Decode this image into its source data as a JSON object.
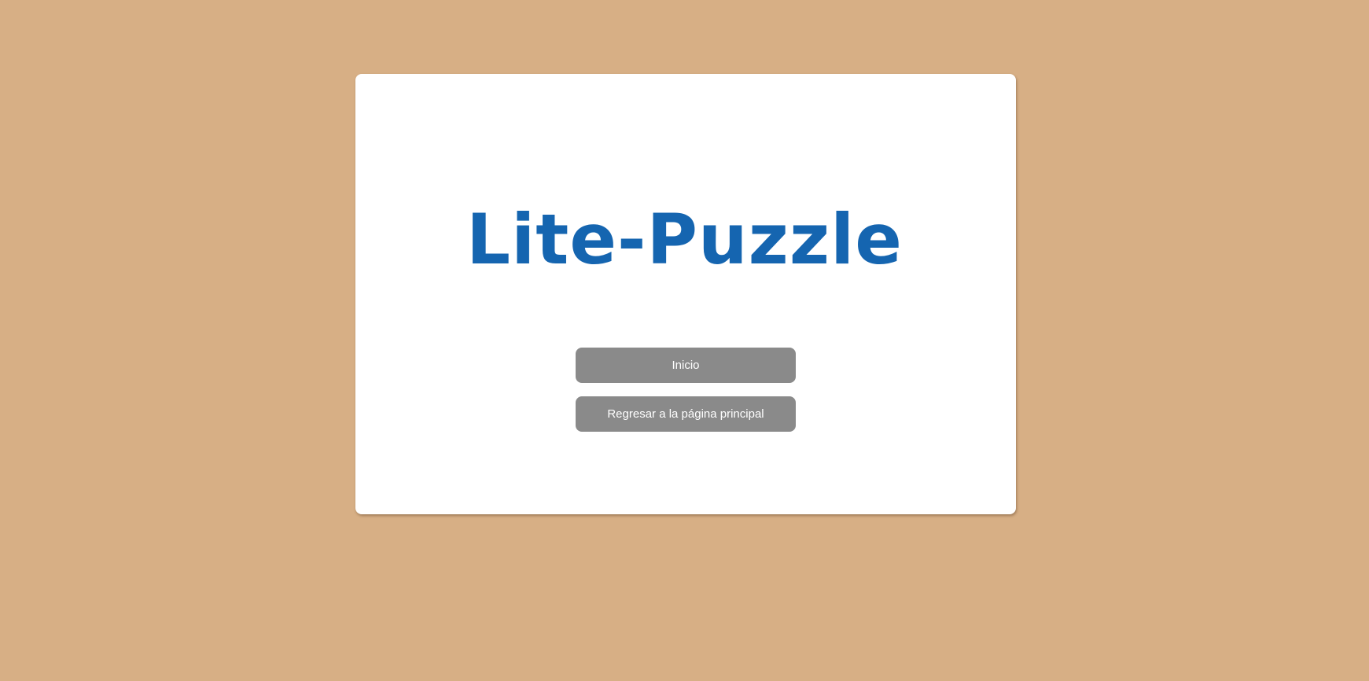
{
  "page": {
    "background_color": "#d7af85",
    "card_color": "#ffffff"
  },
  "title": {
    "text": "Lite-Puzzle",
    "color": "#1565b0"
  },
  "buttons": {
    "start_label": "Inicio",
    "home_label": "Regresar a la página principal",
    "color": "#8a8a8a"
  }
}
